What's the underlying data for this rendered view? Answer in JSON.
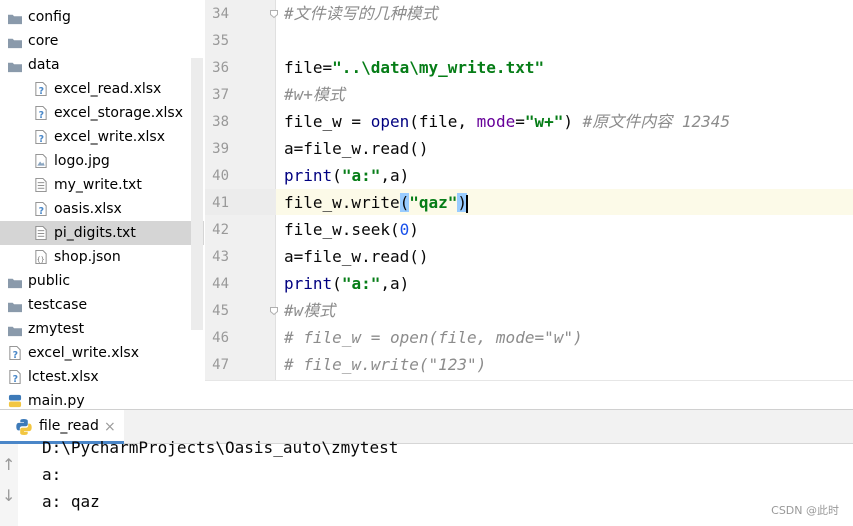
{
  "project_tree": {
    "items": [
      {
        "label": "config",
        "type": "folder",
        "indent": 0
      },
      {
        "label": "core",
        "type": "folder",
        "indent": 0
      },
      {
        "label": "data",
        "type": "folder",
        "indent": 0
      },
      {
        "label": "excel_read.xlsx",
        "type": "xlsx",
        "indent": 1
      },
      {
        "label": "excel_storage.xlsx",
        "type": "xlsx",
        "indent": 1
      },
      {
        "label": "excel_write.xlsx",
        "type": "xlsx",
        "indent": 1
      },
      {
        "label": "logo.jpg",
        "type": "image",
        "indent": 1
      },
      {
        "label": "my_write.txt",
        "type": "text",
        "indent": 1
      },
      {
        "label": "oasis.xlsx",
        "type": "xlsx",
        "indent": 1
      },
      {
        "label": "pi_digits.txt",
        "type": "text",
        "indent": 1,
        "selected": true
      },
      {
        "label": "shop.json",
        "type": "json",
        "indent": 1
      },
      {
        "label": "public",
        "type": "folder",
        "indent": 0
      },
      {
        "label": "testcase",
        "type": "folder",
        "indent": 0
      },
      {
        "label": "zmytest",
        "type": "folder",
        "indent": 0
      },
      {
        "label": "excel_write.xlsx",
        "type": "xlsx",
        "indent": 0
      },
      {
        "label": "lctest.xlsx",
        "type": "xlsx",
        "indent": 0
      },
      {
        "label": "main.py",
        "type": "python",
        "indent": 0
      }
    ]
  },
  "editor": {
    "current_line": "41",
    "lines": [
      {
        "num": "34",
        "tokens": [
          {
            "t": "#文件读写的几种模式",
            "c": "cmt"
          }
        ],
        "fold": true
      },
      {
        "num": "35",
        "tokens": []
      },
      {
        "num": "36",
        "tokens": [
          {
            "t": "file=",
            "c": ""
          },
          {
            "t": "\"..\\data\\my_write.txt\"",
            "c": "str"
          }
        ]
      },
      {
        "num": "37",
        "tokens": [
          {
            "t": "#w+模式",
            "c": "cmt"
          }
        ]
      },
      {
        "num": "38",
        "tokens": [
          {
            "t": "file_w = ",
            "c": ""
          },
          {
            "t": "open",
            "c": "fn"
          },
          {
            "t": "(file, ",
            "c": ""
          },
          {
            "t": "mode",
            "c": "kw"
          },
          {
            "t": "=",
            "c": ""
          },
          {
            "t": "\"w+\"",
            "c": "str"
          },
          {
            "t": ") ",
            "c": ""
          },
          {
            "t": "#原文件内容 12345",
            "c": "cmt"
          }
        ]
      },
      {
        "num": "39",
        "tokens": [
          {
            "t": "a=file_w.read()",
            "c": ""
          }
        ]
      },
      {
        "num": "40",
        "tokens": [
          {
            "t": "print",
            "c": "fn"
          },
          {
            "t": "(",
            "c": ""
          },
          {
            "t": "\"a:\"",
            "c": "str"
          },
          {
            "t": ",a)",
            "c": ""
          }
        ]
      },
      {
        "num": "41",
        "tokens": [
          {
            "t": "file_w.write",
            "c": ""
          },
          {
            "t": "(",
            "c": "paren-hl"
          },
          {
            "t": "\"qaz\"",
            "c": "str"
          },
          {
            "t": ")",
            "c": "paren-hl"
          },
          {
            "t": "",
            "c": "caret"
          }
        ]
      },
      {
        "num": "42",
        "tokens": [
          {
            "t": "file_w.seek(",
            "c": ""
          },
          {
            "t": "0",
            "c": "num"
          },
          {
            "t": ")",
            "c": ""
          }
        ]
      },
      {
        "num": "43",
        "tokens": [
          {
            "t": "a=file_w.read()",
            "c": ""
          }
        ]
      },
      {
        "num": "44",
        "tokens": [
          {
            "t": "print",
            "c": "fn"
          },
          {
            "t": "(",
            "c": ""
          },
          {
            "t": "\"a:\"",
            "c": "str"
          },
          {
            "t": ",a)",
            "c": ""
          }
        ]
      },
      {
        "num": "45",
        "tokens": [
          {
            "t": "#w模式",
            "c": "cmt"
          }
        ],
        "fold": true
      },
      {
        "num": "46",
        "tokens": [
          {
            "t": "# file_w = open(file, mode=\"w\")",
            "c": "cmt"
          }
        ]
      },
      {
        "num": "47",
        "tokens": [
          {
            "t": "# file_w.write(\"123\")",
            "c": "cmt"
          }
        ]
      }
    ]
  },
  "run_panel": {
    "tab_label": "file_read",
    "close_glyph": "×",
    "up_arrow": "↑",
    "down_arrow": "↓",
    "output_lines": [
      "D:\\PycharmProjects\\Oasis_auto\\zmytest",
      "a:",
      "a: qaz"
    ]
  },
  "watermark": "CSDN @此时",
  "colors": {
    "folder": "#8a9aab",
    "python_blue": "#3d7ab8",
    "python_yellow": "#f2c641",
    "tab_underline": "#4a86c8",
    "current_line": "#fcfae8"
  }
}
